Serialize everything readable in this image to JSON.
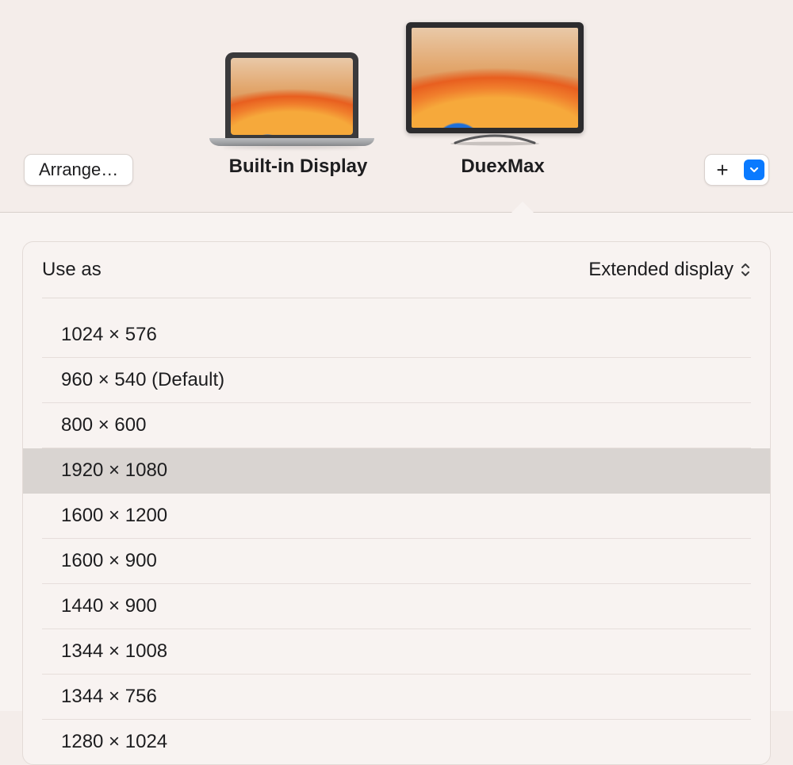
{
  "toolbar": {
    "arrange_label": "Arrange…",
    "add_label": "+"
  },
  "displays": {
    "builtin": {
      "label": "Built-in Display"
    },
    "external": {
      "label": "DuexMax"
    }
  },
  "settings": {
    "use_as_label": "Use as",
    "use_as_value": "Extended display"
  },
  "resolutions": [
    {
      "label": "1024 × 576",
      "selected": false
    },
    {
      "label": "960 × 540 (Default)",
      "selected": false
    },
    {
      "label": "800 × 600",
      "selected": false
    },
    {
      "label": "1920 × 1080",
      "selected": true
    },
    {
      "label": "1600 × 1200",
      "selected": false
    },
    {
      "label": "1600 × 900",
      "selected": false
    },
    {
      "label": "1440 × 900",
      "selected": false
    },
    {
      "label": "1344 × 1008",
      "selected": false
    },
    {
      "label": "1344 × 756",
      "selected": false
    },
    {
      "label": "1280 × 1024",
      "selected": false
    }
  ]
}
